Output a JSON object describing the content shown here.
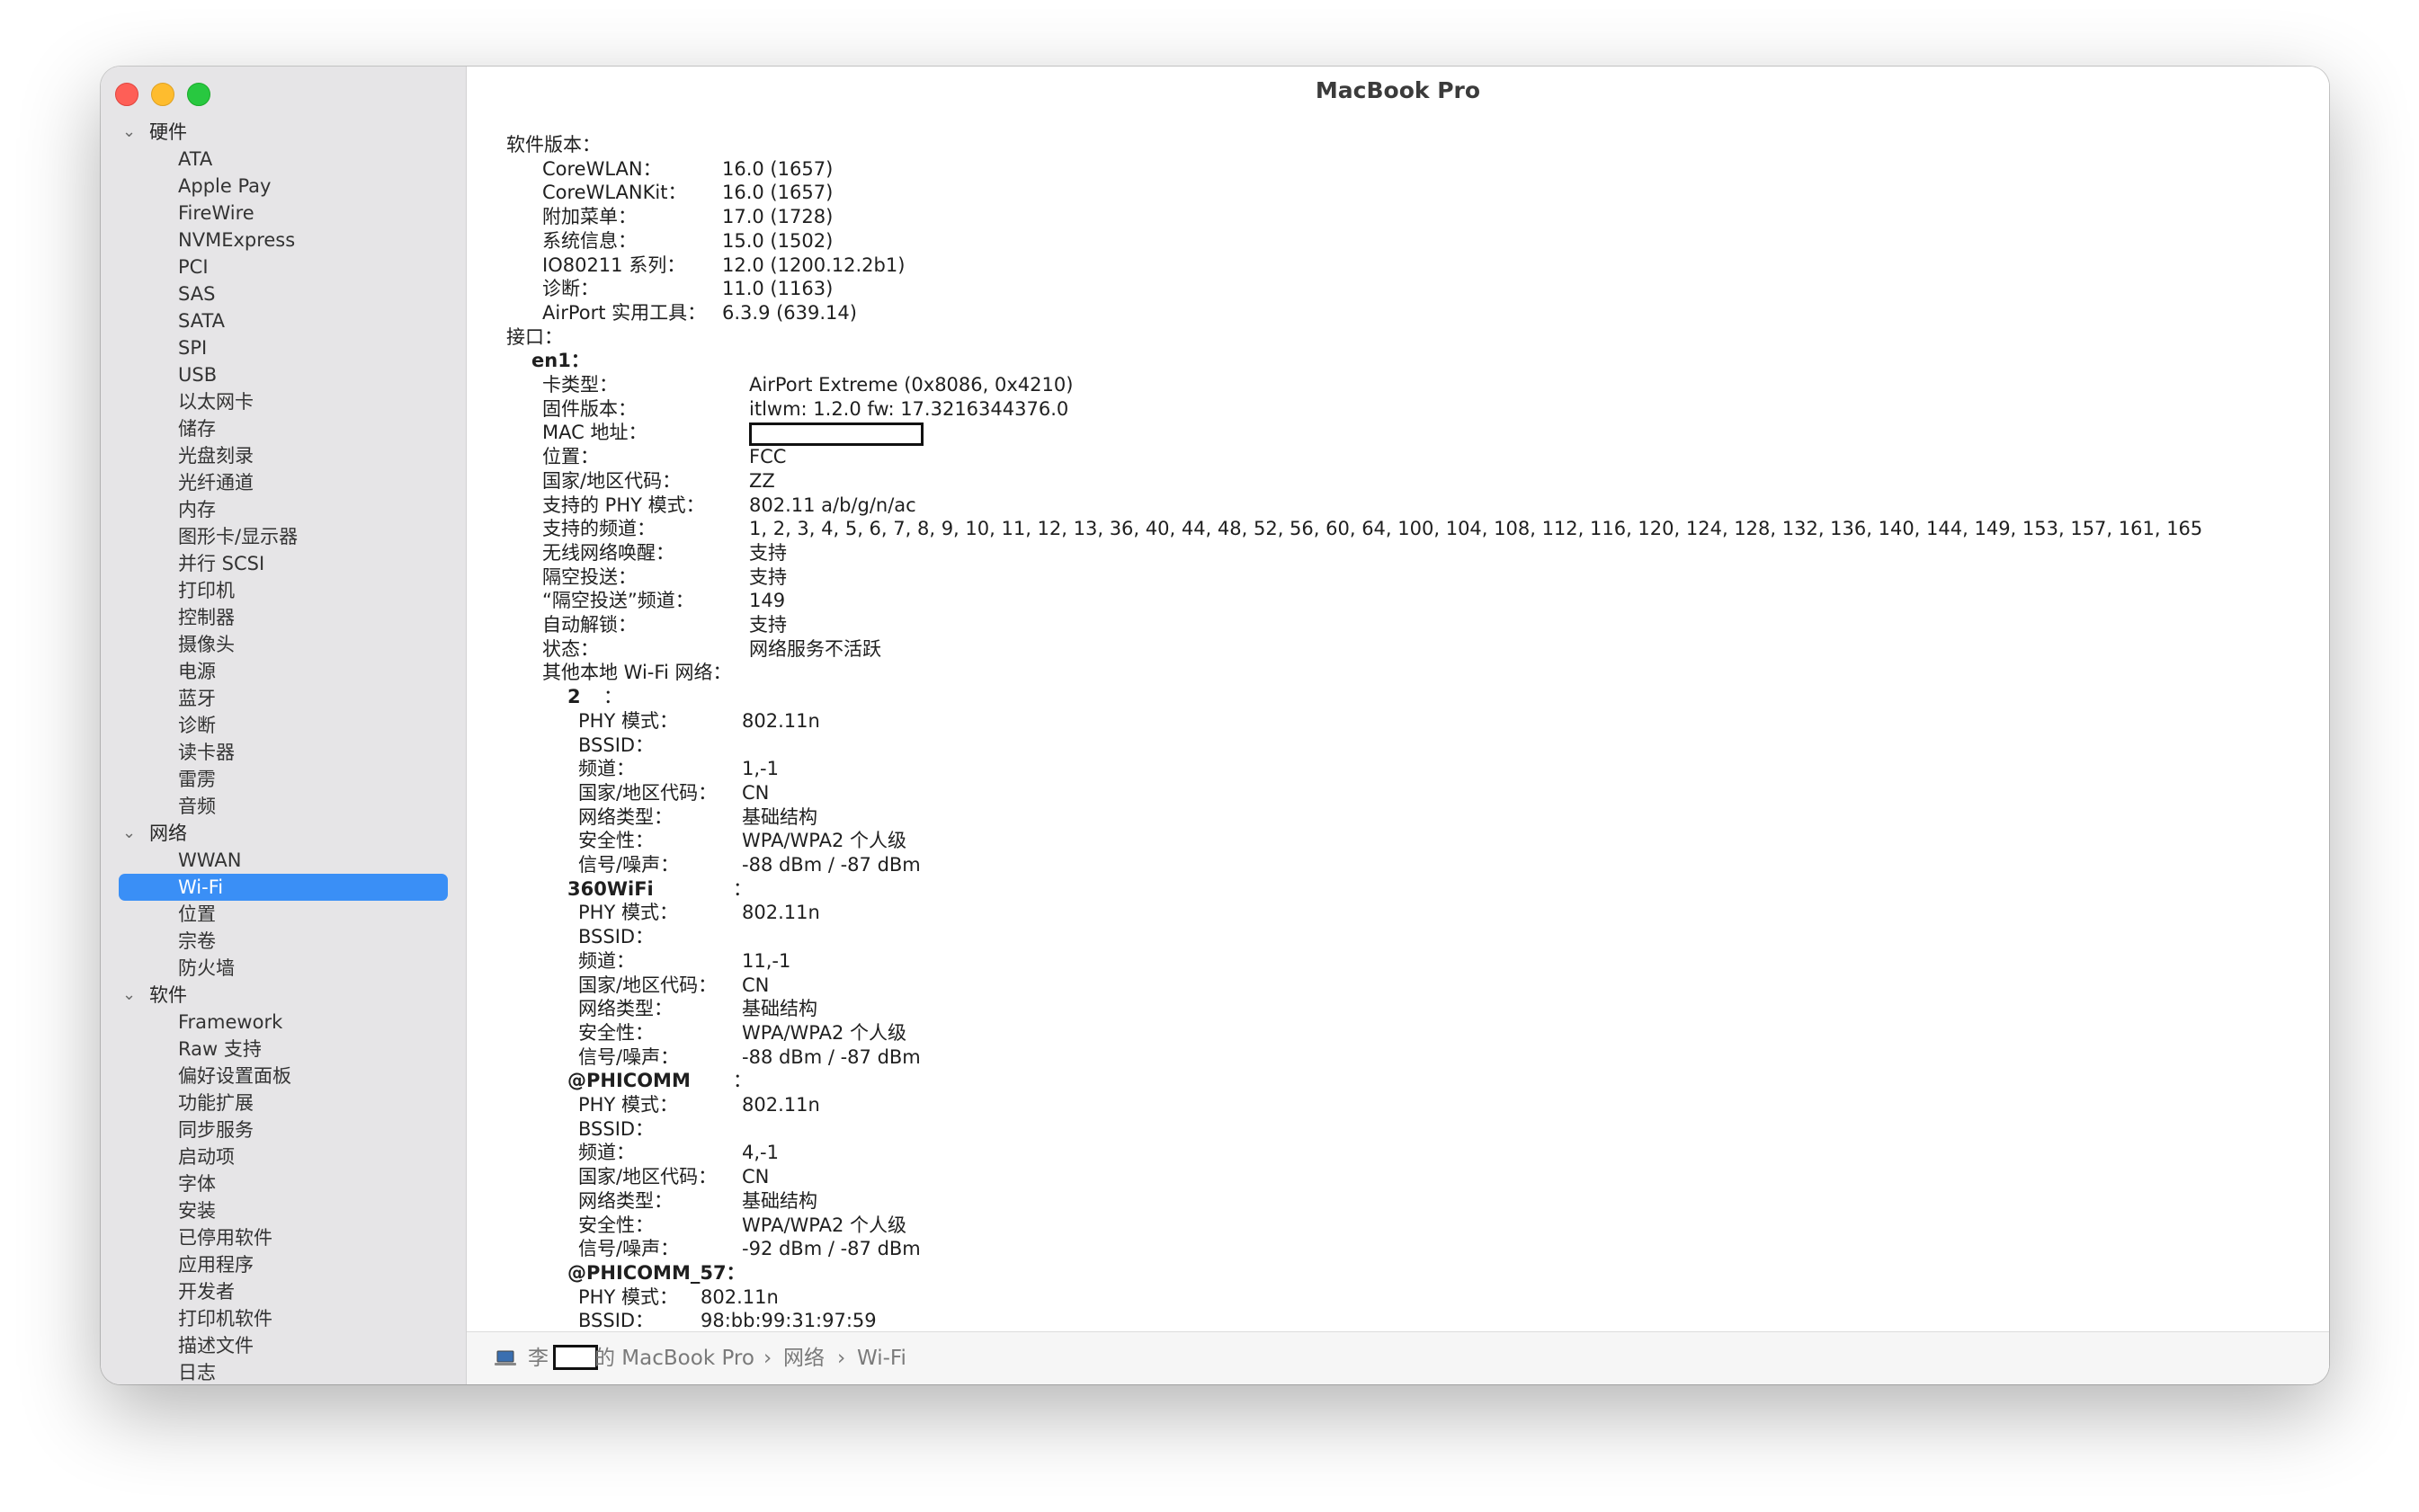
{
  "window": {
    "title": "MacBook Pro"
  },
  "sidebar": {
    "groups": [
      {
        "label": "硬件",
        "items": [
          "ATA",
          "Apple Pay",
          "FireWire",
          "NVMExpress",
          "PCI",
          "SAS",
          "SATA",
          "SPI",
          "USB",
          "以太网卡",
          "储存",
          "光盘刻录",
          "光纤通道",
          "内存",
          "图形卡/显示器",
          "并行 SCSI",
          "打印机",
          "控制器",
          "摄像头",
          "电源",
          "蓝牙",
          "诊断",
          "读卡器",
          "雷雳",
          "音频"
        ]
      },
      {
        "label": "网络",
        "items": [
          "WWAN",
          "Wi-Fi",
          "位置",
          "宗卷",
          "防火墙"
        ]
      },
      {
        "label": "软件",
        "items": [
          "Framework",
          "Raw 支持",
          "偏好设置面板",
          "功能扩展",
          "同步服务",
          "启动项",
          "字体",
          "安装",
          "已停用软件",
          "应用程序",
          "开发者",
          "打印机软件",
          "描述文件",
          "日志"
        ]
      }
    ],
    "selected": "Wi-Fi"
  },
  "report": {
    "software_header": "软件版本：",
    "software": [
      {
        "k": "CoreWLAN：",
        "v": "16.0 (1657)"
      },
      {
        "k": "CoreWLANKit：",
        "v": "16.0 (1657)"
      },
      {
        "k": "附加菜单：",
        "v": "17.0 (1728)"
      },
      {
        "k": "系统信息：",
        "v": "15.0 (1502)"
      },
      {
        "k": "IO80211 系列：",
        "v": "12.0 (1200.12.2b1)"
      },
      {
        "k": "诊断：",
        "v": "11.0 (1163)"
      },
      {
        "k": "AirPort 实用工具：",
        "v": "6.3.9 (639.14)"
      }
    ],
    "interfaces_header": "接口：",
    "interface_name": "en1：",
    "interface": [
      {
        "k": "卡类型：",
        "v": "AirPort Extreme  (0x8086, 0x4210)"
      },
      {
        "k": "固件版本：",
        "v": "itlwm: 1.2.0 fw: 17.3216344376.0"
      },
      {
        "k": "MAC 地址：",
        "v": ""
      },
      {
        "k": "位置：",
        "v": "FCC"
      },
      {
        "k": "国家/地区代码：",
        "v": "ZZ"
      },
      {
        "k": "支持的 PHY 模式：",
        "v": "802.11 a/b/g/n/ac"
      },
      {
        "k": "支持的频道：",
        "v": "1, 2, 3, 4, 5, 6, 7, 8, 9, 10, 11, 12, 13, 36, 40, 44, 48, 52, 56, 60, 64, 100, 104, 108, 112, 116, 120, 124, 128, 132, 136, 140, 144, 149, 153, 157, 161, 165"
      },
      {
        "k": "无线网络唤醒：",
        "v": "支持"
      },
      {
        "k": "隔空投送：",
        "v": "支持"
      },
      {
        "k": "“隔空投送”频道：",
        "v": "149"
      },
      {
        "k": "自动解锁：",
        "v": "支持"
      },
      {
        "k": "状态：",
        "v": "网络服务不活跃"
      }
    ],
    "other_networks_header": "其他本地 Wi-Fi 网络：",
    "networks": [
      {
        "name": "2",
        "colon": "：",
        "fields": [
          {
            "k": "PHY 模式：",
            "v": "802.11n"
          },
          {
            "k": "BSSID：",
            "v": ""
          },
          {
            "k": "频道：",
            "v": "1,-1"
          },
          {
            "k": "国家/地区代码：",
            "v": "CN"
          },
          {
            "k": "网络类型：",
            "v": "基础结构"
          },
          {
            "k": "安全性：",
            "v": "WPA/WPA2 个人级"
          },
          {
            "k": "信号/噪声：",
            "v": "-88 dBm / -87 dBm"
          }
        ]
      },
      {
        "name": "360WiFi",
        "colon": "：",
        "fields": [
          {
            "k": "PHY 模式：",
            "v": "802.11n"
          },
          {
            "k": "BSSID：",
            "v": ""
          },
          {
            "k": "频道：",
            "v": "11,-1"
          },
          {
            "k": "国家/地区代码：",
            "v": "CN"
          },
          {
            "k": "网络类型：",
            "v": "基础结构"
          },
          {
            "k": "安全性：",
            "v": "WPA/WPA2 个人级"
          },
          {
            "k": "信号/噪声：",
            "v": "-88 dBm / -87 dBm"
          }
        ]
      },
      {
        "name": "@PHICOMM",
        "colon": "：",
        "fields": [
          {
            "k": "PHY 模式：",
            "v": "802.11n"
          },
          {
            "k": "BSSID：",
            "v": ""
          },
          {
            "k": "频道：",
            "v": "4,-1"
          },
          {
            "k": "国家/地区代码：",
            "v": "CN"
          },
          {
            "k": "网络类型：",
            "v": "基础结构"
          },
          {
            "k": "安全性：",
            "v": "WPA/WPA2 个人级"
          },
          {
            "k": "信号/噪声：",
            "v": "-92 dBm / -87 dBm"
          }
        ]
      },
      {
        "name": "@PHICOMM_57：",
        "colon": "",
        "fields": [
          {
            "k": "PHY 模式：",
            "v": "802.11n"
          },
          {
            "k": "BSSID：",
            "v": "98:bb:99:31:97:59"
          }
        ]
      }
    ]
  },
  "breadcrumb": {
    "owner_prefix": "李",
    "owner_suffix": "的 MacBook Pro",
    "sep": "›",
    "items": [
      "网络",
      "Wi-Fi"
    ]
  }
}
